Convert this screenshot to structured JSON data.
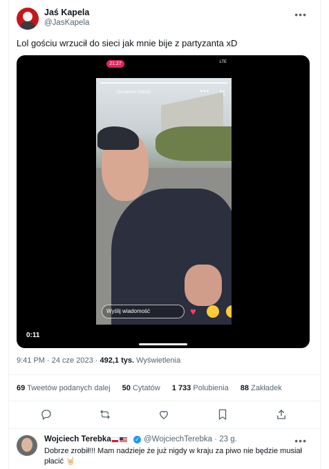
{
  "tweet": {
    "author_name": "Jaś Kapela",
    "author_handle": "@JasKapela",
    "more_icon": "•••",
    "text": "Lol gościu wrzucił do sieci jak mnie bije z partyzanta xD",
    "video": {
      "recording_time": "21:27",
      "network": "LTE",
      "story_title": "Oczarnie mamy",
      "close_symbol": "✕",
      "message_placeholder": "Wyślij wiadomość",
      "elapsed": "0:11"
    },
    "time": "9:41 PM",
    "date": "24 cze 2023",
    "views_count": "492,1 tys.",
    "views_label": "Wyświetlenia",
    "stats": [
      {
        "count": "69",
        "label": "Tweetów podanych dalej"
      },
      {
        "count": "50",
        "label": "Cytatów"
      },
      {
        "count": "1 733",
        "label": "Polubienia"
      },
      {
        "count": "88",
        "label": "Zakładek"
      }
    ],
    "actions": [
      "reply-icon",
      "retweet-icon",
      "like-icon",
      "bookmark-icon",
      "share-icon"
    ]
  },
  "reply": {
    "author_name": "Wojciech Terebka",
    "author_handle": "@WojciechTerebka",
    "time": "· 23 g.",
    "text": "Dobrze zrobił!!! Mam nadzieje że już nigdy w kraju za piwo nie będzie musiał płacić 🤘🏻",
    "more_icon": "•••"
  },
  "colors": {
    "text_primary": "#0f1419",
    "text_secondary": "#536471",
    "accent": "#1d9bf0",
    "divider": "#eff3f4"
  }
}
